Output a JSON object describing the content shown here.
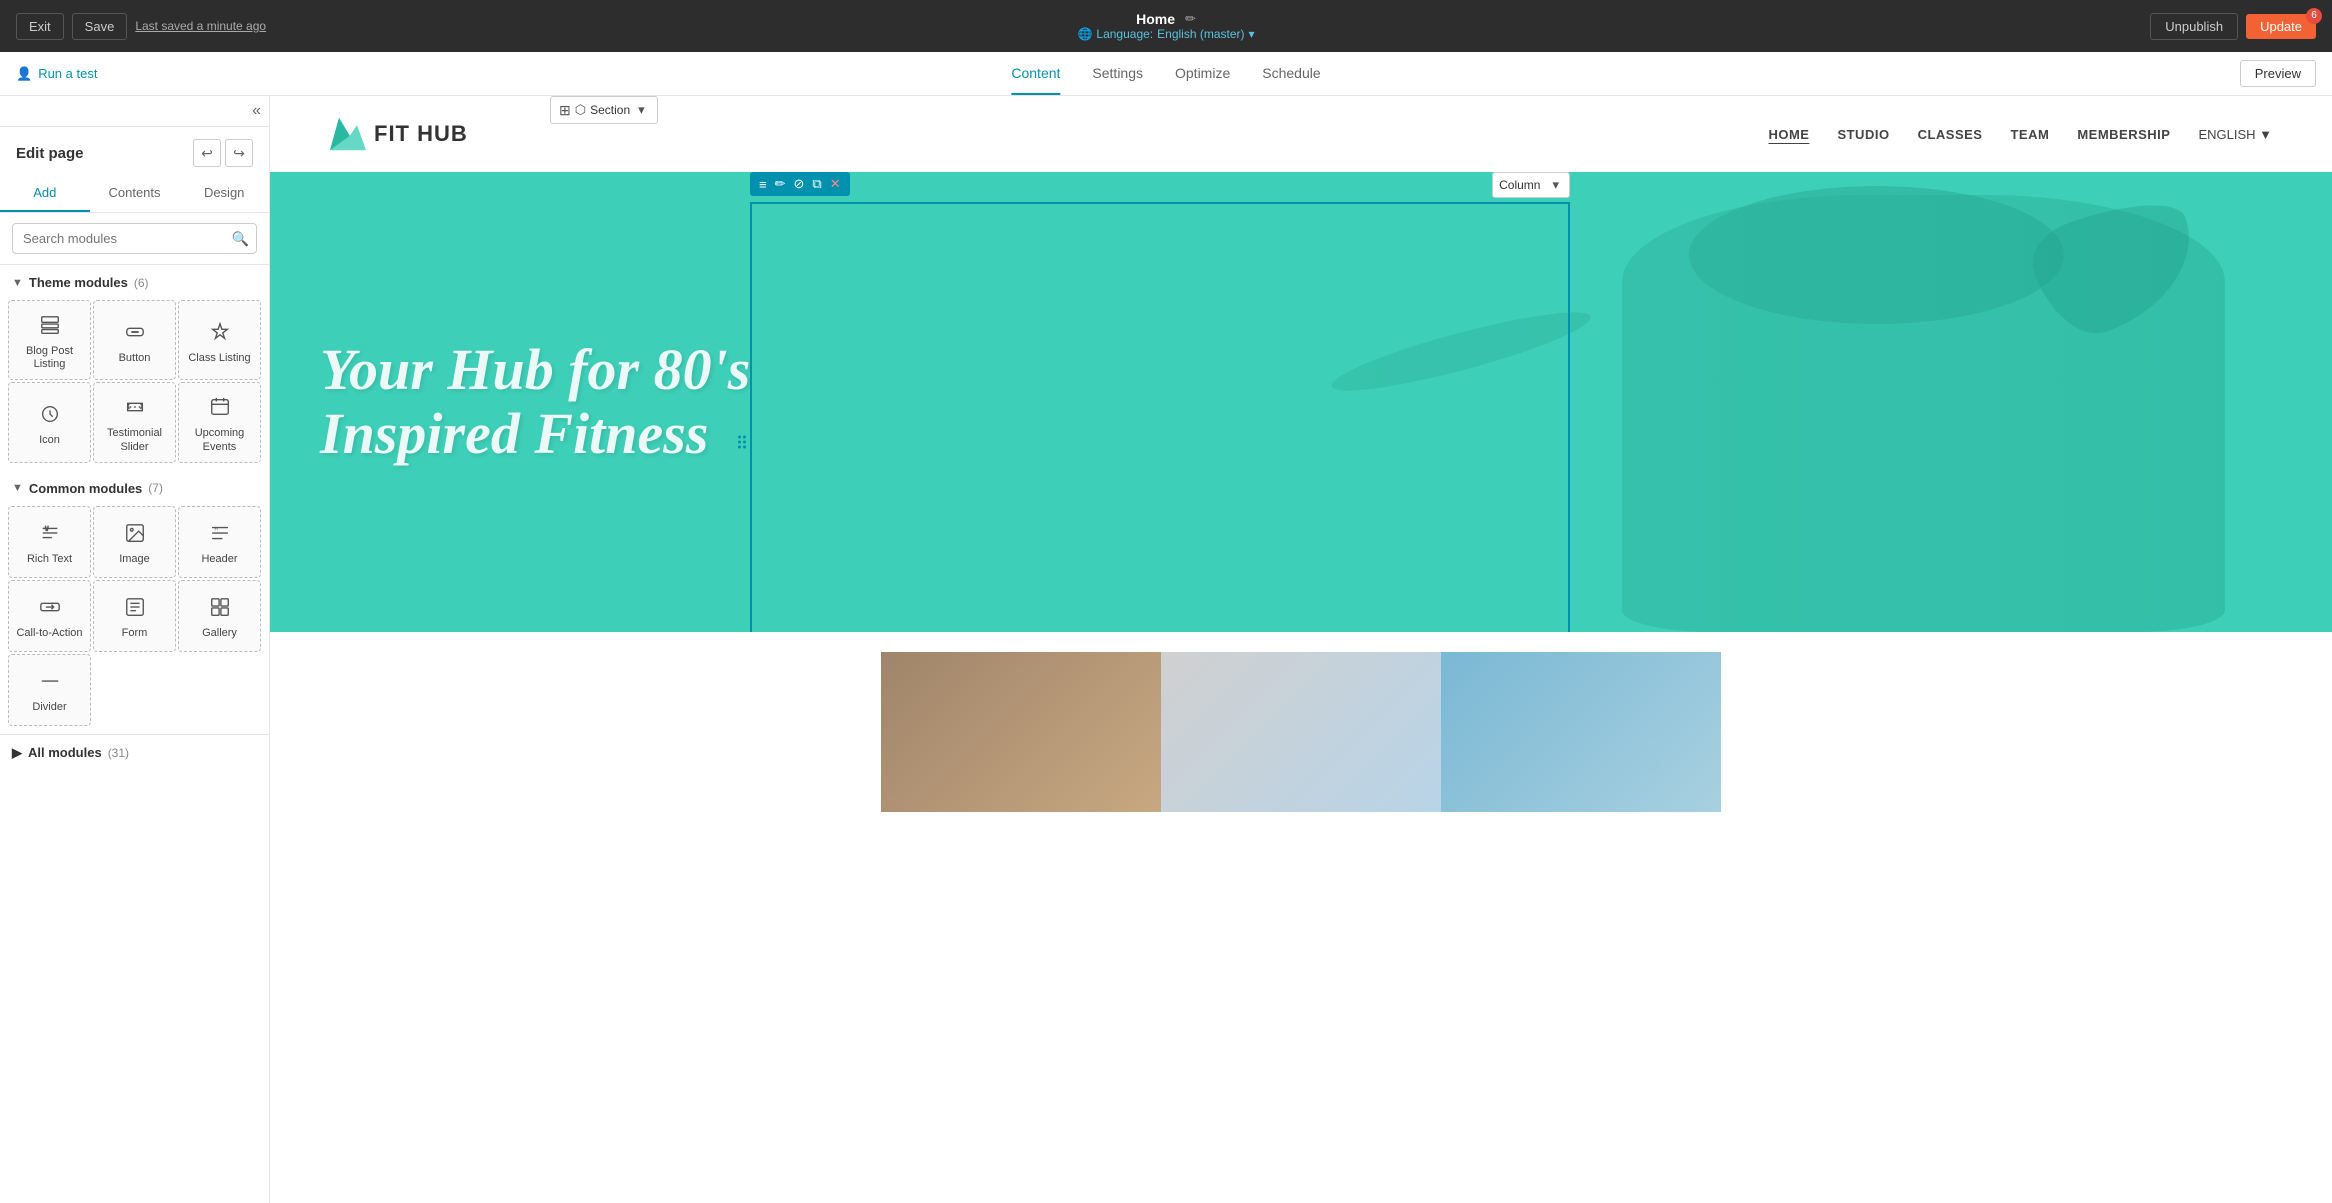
{
  "topbar": {
    "exit_label": "Exit",
    "save_label": "Save",
    "last_saved": "Last saved a minute ago",
    "page_title": "Home",
    "edit_icon": "✏",
    "language_label": "Language:",
    "language_value": "English (master)",
    "language_dropdown": "▾",
    "unpublish_label": "Unpublish",
    "update_label": "Update",
    "update_badge": "6"
  },
  "subnav": {
    "run_test": "Run a test",
    "tabs": [
      "Content",
      "Settings",
      "Optimize",
      "Schedule"
    ],
    "active_tab": "Content",
    "preview_label": "Preview"
  },
  "sidebar": {
    "title": "Edit page",
    "undo_icon": "↩",
    "redo_icon": "↪",
    "tabs": [
      "Add",
      "Contents",
      "Design"
    ],
    "active_tab": "Add",
    "search_placeholder": "Search modules",
    "collapse_icon": "«",
    "theme_modules_label": "Theme modules",
    "theme_modules_count": "(6)",
    "common_modules_label": "Common modules",
    "common_modules_count": "(7)",
    "all_modules_label": "All modules",
    "all_modules_count": "(31)",
    "theme_modules": [
      {
        "id": "blog-post-listing",
        "label": "Blog Post Listing",
        "icon": "blog"
      },
      {
        "id": "button",
        "label": "Button",
        "icon": "button"
      },
      {
        "id": "class-listing",
        "label": "Class Listing",
        "icon": "class"
      },
      {
        "id": "icon",
        "label": "Icon",
        "icon": "icon"
      },
      {
        "id": "testimonial-slider",
        "label": "Testimonial Slider",
        "icon": "testimonial"
      },
      {
        "id": "upcoming-events",
        "label": "Upcoming Events",
        "icon": "events"
      }
    ],
    "common_modules": [
      {
        "id": "rich-text",
        "label": "Rich Text",
        "icon": "richtext"
      },
      {
        "id": "image",
        "label": "Image",
        "icon": "image"
      },
      {
        "id": "header",
        "label": "Header",
        "icon": "header"
      },
      {
        "id": "call-to-action",
        "label": "Call-to-Action",
        "icon": "cta"
      },
      {
        "id": "form",
        "label": "Form",
        "icon": "form"
      },
      {
        "id": "gallery",
        "label": "Gallery",
        "icon": "gallery"
      },
      {
        "id": "divider",
        "label": "Divider",
        "icon": "divider"
      }
    ]
  },
  "section_toolbar": {
    "label": "Section",
    "dropdown": "▾"
  },
  "column_toolbar": {
    "label": "Column",
    "dropdown": "▾"
  },
  "site": {
    "logo_text": "FIT HUB",
    "nav_links": [
      "HOME",
      "STUDIO",
      "CLASSES",
      "TEAM",
      "MEMBERSHIP",
      "ENGLISH ▼"
    ],
    "hero_line1": "Your Hub for 80's",
    "hero_line2": "Inspired Fitness"
  }
}
